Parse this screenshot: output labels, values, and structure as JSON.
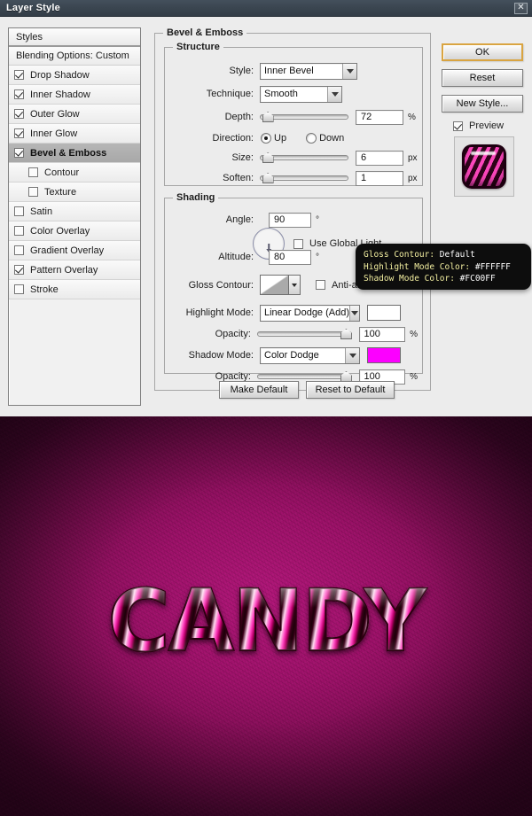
{
  "window": {
    "title": "Layer Style",
    "close_icon": "close-icon"
  },
  "styles_panel": {
    "header": "Styles",
    "blending_options": "Blending Options: Custom",
    "effects": [
      {
        "label": "Drop Shadow",
        "checked": true,
        "indent": false,
        "selected": false
      },
      {
        "label": "Inner Shadow",
        "checked": true,
        "indent": false,
        "selected": false
      },
      {
        "label": "Outer Glow",
        "checked": true,
        "indent": false,
        "selected": false
      },
      {
        "label": "Inner Glow",
        "checked": true,
        "indent": false,
        "selected": false
      },
      {
        "label": "Bevel & Emboss",
        "checked": true,
        "indent": false,
        "selected": true
      },
      {
        "label": "Contour",
        "checked": false,
        "indent": true,
        "selected": false
      },
      {
        "label": "Texture",
        "checked": false,
        "indent": true,
        "selected": false
      },
      {
        "label": "Satin",
        "checked": false,
        "indent": false,
        "selected": false
      },
      {
        "label": "Color Overlay",
        "checked": false,
        "indent": false,
        "selected": false
      },
      {
        "label": "Gradient Overlay",
        "checked": false,
        "indent": false,
        "selected": false
      },
      {
        "label": "Pattern Overlay",
        "checked": true,
        "indent": false,
        "selected": false
      },
      {
        "label": "Stroke",
        "checked": false,
        "indent": false,
        "selected": false
      }
    ]
  },
  "bevel": {
    "group_title": "Bevel & Emboss",
    "structure": {
      "group_title": "Structure",
      "style_label": "Style:",
      "style_value": "Inner Bevel",
      "technique_label": "Technique:",
      "technique_value": "Smooth",
      "depth_label": "Depth:",
      "depth_value": "72",
      "depth_unit": "%",
      "depth_percent": 3,
      "direction_label": "Direction:",
      "direction_up": "Up",
      "direction_down": "Down",
      "direction_selected": "Up",
      "size_label": "Size:",
      "size_value": "6",
      "size_unit": "px",
      "size_percent": 3,
      "soften_label": "Soften:",
      "soften_value": "1",
      "soften_unit": "px",
      "soften_percent": 3
    },
    "shading": {
      "group_title": "Shading",
      "angle_label": "Angle:",
      "angle_value": "90",
      "angle_unit": "°",
      "use_global_light": "Use Global Light",
      "use_global_light_checked": false,
      "altitude_label": "Altitude:",
      "altitude_value": "80",
      "altitude_unit": "°",
      "gloss_contour_label": "Gloss Contour:",
      "anti_aliased": "Anti-aliased",
      "anti_aliased_checked": false,
      "highlight_mode_label": "Highlight Mode:",
      "highlight_mode_value": "Linear Dodge (Add)",
      "highlight_color": "#FFFFFF",
      "highlight_opacity_label": "Opacity:",
      "highlight_opacity_value": "100",
      "highlight_opacity_unit": "%",
      "highlight_opacity_percent": 100,
      "shadow_mode_label": "Shadow Mode:",
      "shadow_mode_value": "Color Dodge",
      "shadow_color": "#FC00FF",
      "shadow_opacity_label": "Opacity:",
      "shadow_opacity_value": "100",
      "shadow_opacity_unit": "%",
      "shadow_opacity_percent": 100
    },
    "make_default": "Make Default",
    "reset_to_default": "Reset to Default"
  },
  "right_column": {
    "ok": "OK",
    "reset": "Reset",
    "new_style": "New Style...",
    "preview_label": "Preview",
    "preview_checked": true
  },
  "tooltip": {
    "lines": [
      {
        "key": "Gloss Contour:",
        "value": "Default"
      },
      {
        "key": "Highlight Mode Color:",
        "value": "#FFFFFF"
      },
      {
        "key": "Shadow Mode Color:",
        "value": "#FC00FF"
      }
    ]
  },
  "artwork": {
    "text": "CANDY",
    "background_center": "#b2177a",
    "background_edge": "#4d0733"
  }
}
